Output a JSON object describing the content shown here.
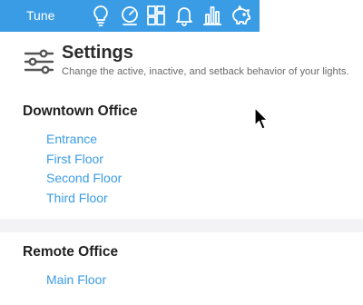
{
  "app": {
    "brand": "Tune"
  },
  "nav": [
    {
      "icon": "lightbulb-icon"
    },
    {
      "icon": "gauge-icon"
    },
    {
      "icon": "dashboard-grid-icon"
    },
    {
      "icon": "bell-icon"
    },
    {
      "icon": "bar-chart-icon"
    },
    {
      "icon": "piggy-bank-icon"
    }
  ],
  "header": {
    "icon": "settings-sliders-icon",
    "title": "Settings",
    "subtitle": "Change the active, inactive, and setback behavior of your lights."
  },
  "locations": [
    {
      "name": "Downtown Office",
      "floors": [
        "Entrance",
        "First Floor",
        "Second Floor",
        "Third Floor"
      ]
    },
    {
      "name": "Remote Office",
      "floors": [
        "Main Floor"
      ]
    }
  ],
  "colors": {
    "accent": "#3b9ce6",
    "background": "#f3f3f5",
    "text": "#2b2b2b"
  }
}
